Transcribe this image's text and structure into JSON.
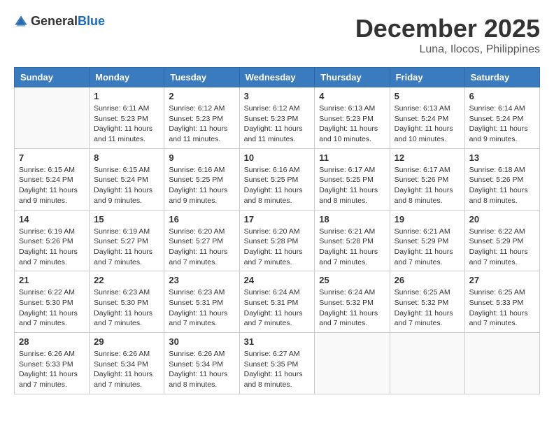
{
  "header": {
    "logo_general": "General",
    "logo_blue": "Blue",
    "month": "December 2025",
    "location": "Luna, Ilocos, Philippines"
  },
  "days_of_week": [
    "Sunday",
    "Monday",
    "Tuesday",
    "Wednesday",
    "Thursday",
    "Friday",
    "Saturday"
  ],
  "weeks": [
    [
      {
        "day": "",
        "sunrise": "",
        "sunset": "",
        "daylight": ""
      },
      {
        "day": "1",
        "sunrise": "6:11 AM",
        "sunset": "5:23 PM",
        "daylight": "11 hours and 11 minutes."
      },
      {
        "day": "2",
        "sunrise": "6:12 AM",
        "sunset": "5:23 PM",
        "daylight": "11 hours and 11 minutes."
      },
      {
        "day": "3",
        "sunrise": "6:12 AM",
        "sunset": "5:23 PM",
        "daylight": "11 hours and 11 minutes."
      },
      {
        "day": "4",
        "sunrise": "6:13 AM",
        "sunset": "5:23 PM",
        "daylight": "11 hours and 10 minutes."
      },
      {
        "day": "5",
        "sunrise": "6:13 AM",
        "sunset": "5:24 PM",
        "daylight": "11 hours and 10 minutes."
      },
      {
        "day": "6",
        "sunrise": "6:14 AM",
        "sunset": "5:24 PM",
        "daylight": "11 hours and 9 minutes."
      }
    ],
    [
      {
        "day": "7",
        "sunrise": "6:15 AM",
        "sunset": "5:24 PM",
        "daylight": "11 hours and 9 minutes."
      },
      {
        "day": "8",
        "sunrise": "6:15 AM",
        "sunset": "5:24 PM",
        "daylight": "11 hours and 9 minutes."
      },
      {
        "day": "9",
        "sunrise": "6:16 AM",
        "sunset": "5:25 PM",
        "daylight": "11 hours and 9 minutes."
      },
      {
        "day": "10",
        "sunrise": "6:16 AM",
        "sunset": "5:25 PM",
        "daylight": "11 hours and 8 minutes."
      },
      {
        "day": "11",
        "sunrise": "6:17 AM",
        "sunset": "5:25 PM",
        "daylight": "11 hours and 8 minutes."
      },
      {
        "day": "12",
        "sunrise": "6:17 AM",
        "sunset": "5:26 PM",
        "daylight": "11 hours and 8 minutes."
      },
      {
        "day": "13",
        "sunrise": "6:18 AM",
        "sunset": "5:26 PM",
        "daylight": "11 hours and 8 minutes."
      }
    ],
    [
      {
        "day": "14",
        "sunrise": "6:19 AM",
        "sunset": "5:26 PM",
        "daylight": "11 hours and 7 minutes."
      },
      {
        "day": "15",
        "sunrise": "6:19 AM",
        "sunset": "5:27 PM",
        "daylight": "11 hours and 7 minutes."
      },
      {
        "day": "16",
        "sunrise": "6:20 AM",
        "sunset": "5:27 PM",
        "daylight": "11 hours and 7 minutes."
      },
      {
        "day": "17",
        "sunrise": "6:20 AM",
        "sunset": "5:28 PM",
        "daylight": "11 hours and 7 minutes."
      },
      {
        "day": "18",
        "sunrise": "6:21 AM",
        "sunset": "5:28 PM",
        "daylight": "11 hours and 7 minutes."
      },
      {
        "day": "19",
        "sunrise": "6:21 AM",
        "sunset": "5:29 PM",
        "daylight": "11 hours and 7 minutes."
      },
      {
        "day": "20",
        "sunrise": "6:22 AM",
        "sunset": "5:29 PM",
        "daylight": "11 hours and 7 minutes."
      }
    ],
    [
      {
        "day": "21",
        "sunrise": "6:22 AM",
        "sunset": "5:30 PM",
        "daylight": "11 hours and 7 minutes."
      },
      {
        "day": "22",
        "sunrise": "6:23 AM",
        "sunset": "5:30 PM",
        "daylight": "11 hours and 7 minutes."
      },
      {
        "day": "23",
        "sunrise": "6:23 AM",
        "sunset": "5:31 PM",
        "daylight": "11 hours and 7 minutes."
      },
      {
        "day": "24",
        "sunrise": "6:24 AM",
        "sunset": "5:31 PM",
        "daylight": "11 hours and 7 minutes."
      },
      {
        "day": "25",
        "sunrise": "6:24 AM",
        "sunset": "5:32 PM",
        "daylight": "11 hours and 7 minutes."
      },
      {
        "day": "26",
        "sunrise": "6:25 AM",
        "sunset": "5:32 PM",
        "daylight": "11 hours and 7 minutes."
      },
      {
        "day": "27",
        "sunrise": "6:25 AM",
        "sunset": "5:33 PM",
        "daylight": "11 hours and 7 minutes."
      }
    ],
    [
      {
        "day": "28",
        "sunrise": "6:26 AM",
        "sunset": "5:33 PM",
        "daylight": "11 hours and 7 minutes."
      },
      {
        "day": "29",
        "sunrise": "6:26 AM",
        "sunset": "5:34 PM",
        "daylight": "11 hours and 7 minutes."
      },
      {
        "day": "30",
        "sunrise": "6:26 AM",
        "sunset": "5:34 PM",
        "daylight": "11 hours and 8 minutes."
      },
      {
        "day": "31",
        "sunrise": "6:27 AM",
        "sunset": "5:35 PM",
        "daylight": "11 hours and 8 minutes."
      },
      {
        "day": "",
        "sunrise": "",
        "sunset": "",
        "daylight": ""
      },
      {
        "day": "",
        "sunrise": "",
        "sunset": "",
        "daylight": ""
      },
      {
        "day": "",
        "sunrise": "",
        "sunset": "",
        "daylight": ""
      }
    ]
  ],
  "labels": {
    "sunrise": "Sunrise:",
    "sunset": "Sunset:",
    "daylight": "Daylight:"
  }
}
